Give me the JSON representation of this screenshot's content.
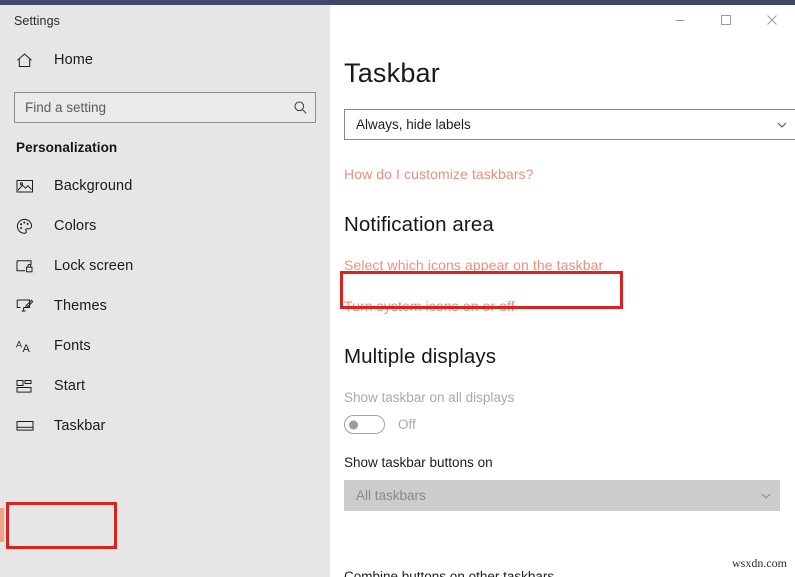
{
  "window": {
    "app_title": "Settings",
    "controls": {
      "minimize": "minimize-button",
      "maximize": "maximize-button",
      "close": "close-button"
    }
  },
  "sidebar": {
    "home_label": "Home",
    "search": {
      "placeholder": "Find a setting",
      "value": ""
    },
    "section_label": "Personalization",
    "items": [
      {
        "label": "Background",
        "icon": "picture-icon"
      },
      {
        "label": "Colors",
        "icon": "palette-icon"
      },
      {
        "label": "Lock screen",
        "icon": "lock-screen-icon"
      },
      {
        "label": "Themes",
        "icon": "themes-brush-icon"
      },
      {
        "label": "Fonts",
        "icon": "fonts-aa-icon"
      },
      {
        "label": "Start",
        "icon": "start-tiles-icon"
      },
      {
        "label": "Taskbar",
        "icon": "taskbar-icon",
        "selected": true
      }
    ]
  },
  "main": {
    "page_title": "Taskbar",
    "combine_dropdown": {
      "value": "Always, hide labels"
    },
    "help_link": "How do I customize taskbars?",
    "notification_area": {
      "heading": "Notification area",
      "link_select_icons": "Select which icons appear on the taskbar",
      "link_system_icons": "Turn system icons on or off"
    },
    "multiple_displays": {
      "heading": "Multiple displays",
      "show_on_all_label": "Show taskbar on all displays",
      "toggle_state": "Off",
      "buttons_on_label": "Show taskbar buttons on",
      "buttons_on_value": "All taskbars"
    },
    "cut_off_text": "Combine buttons on other taskbars"
  },
  "annotations": {
    "color": "#d9231e",
    "accent_color": "#f2a183"
  },
  "watermark": "wsxdn.com"
}
